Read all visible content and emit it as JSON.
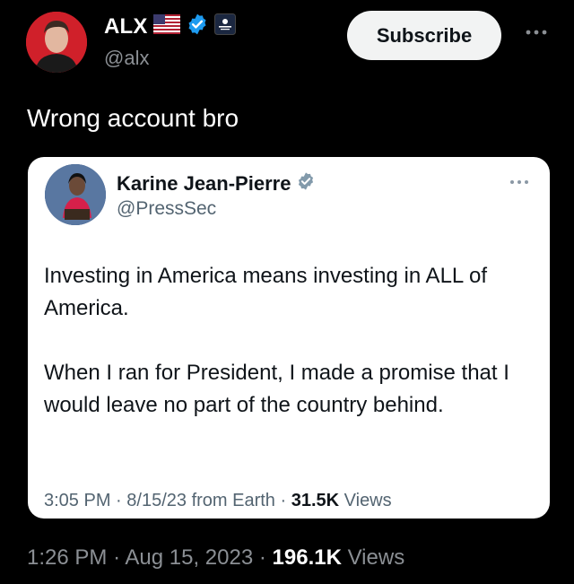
{
  "author": {
    "name": "ALX",
    "handle": "@alx",
    "badges": [
      "us-flag-icon",
      "verified-badge-icon",
      "organization-badge-icon"
    ]
  },
  "subscribe_label": "Subscribe",
  "tweet_text": "Wrong account bro",
  "quoted": {
    "name": "Karine Jean-Pierre",
    "handle": "@PressSec",
    "badge": "verified-gray-badge-icon",
    "paragraphs": [
      "Investing in America means investing in ALL of America.",
      "When I ran for President, I made a promise that I would leave no part of the country behind."
    ],
    "time": "3:05 PM",
    "date": "8/15/23",
    "source": "from Earth",
    "views_count": "31.5K",
    "views_label": "Views"
  },
  "meta": {
    "time": "1:26 PM",
    "date": "Aug 15, 2023",
    "views_count": "196.1K",
    "views_label": "Views"
  },
  "colors": {
    "background": "#000000",
    "verified_blue": "#1d9bf0",
    "secondary_text": "#8b8f94",
    "quote_secondary": "#536471"
  }
}
